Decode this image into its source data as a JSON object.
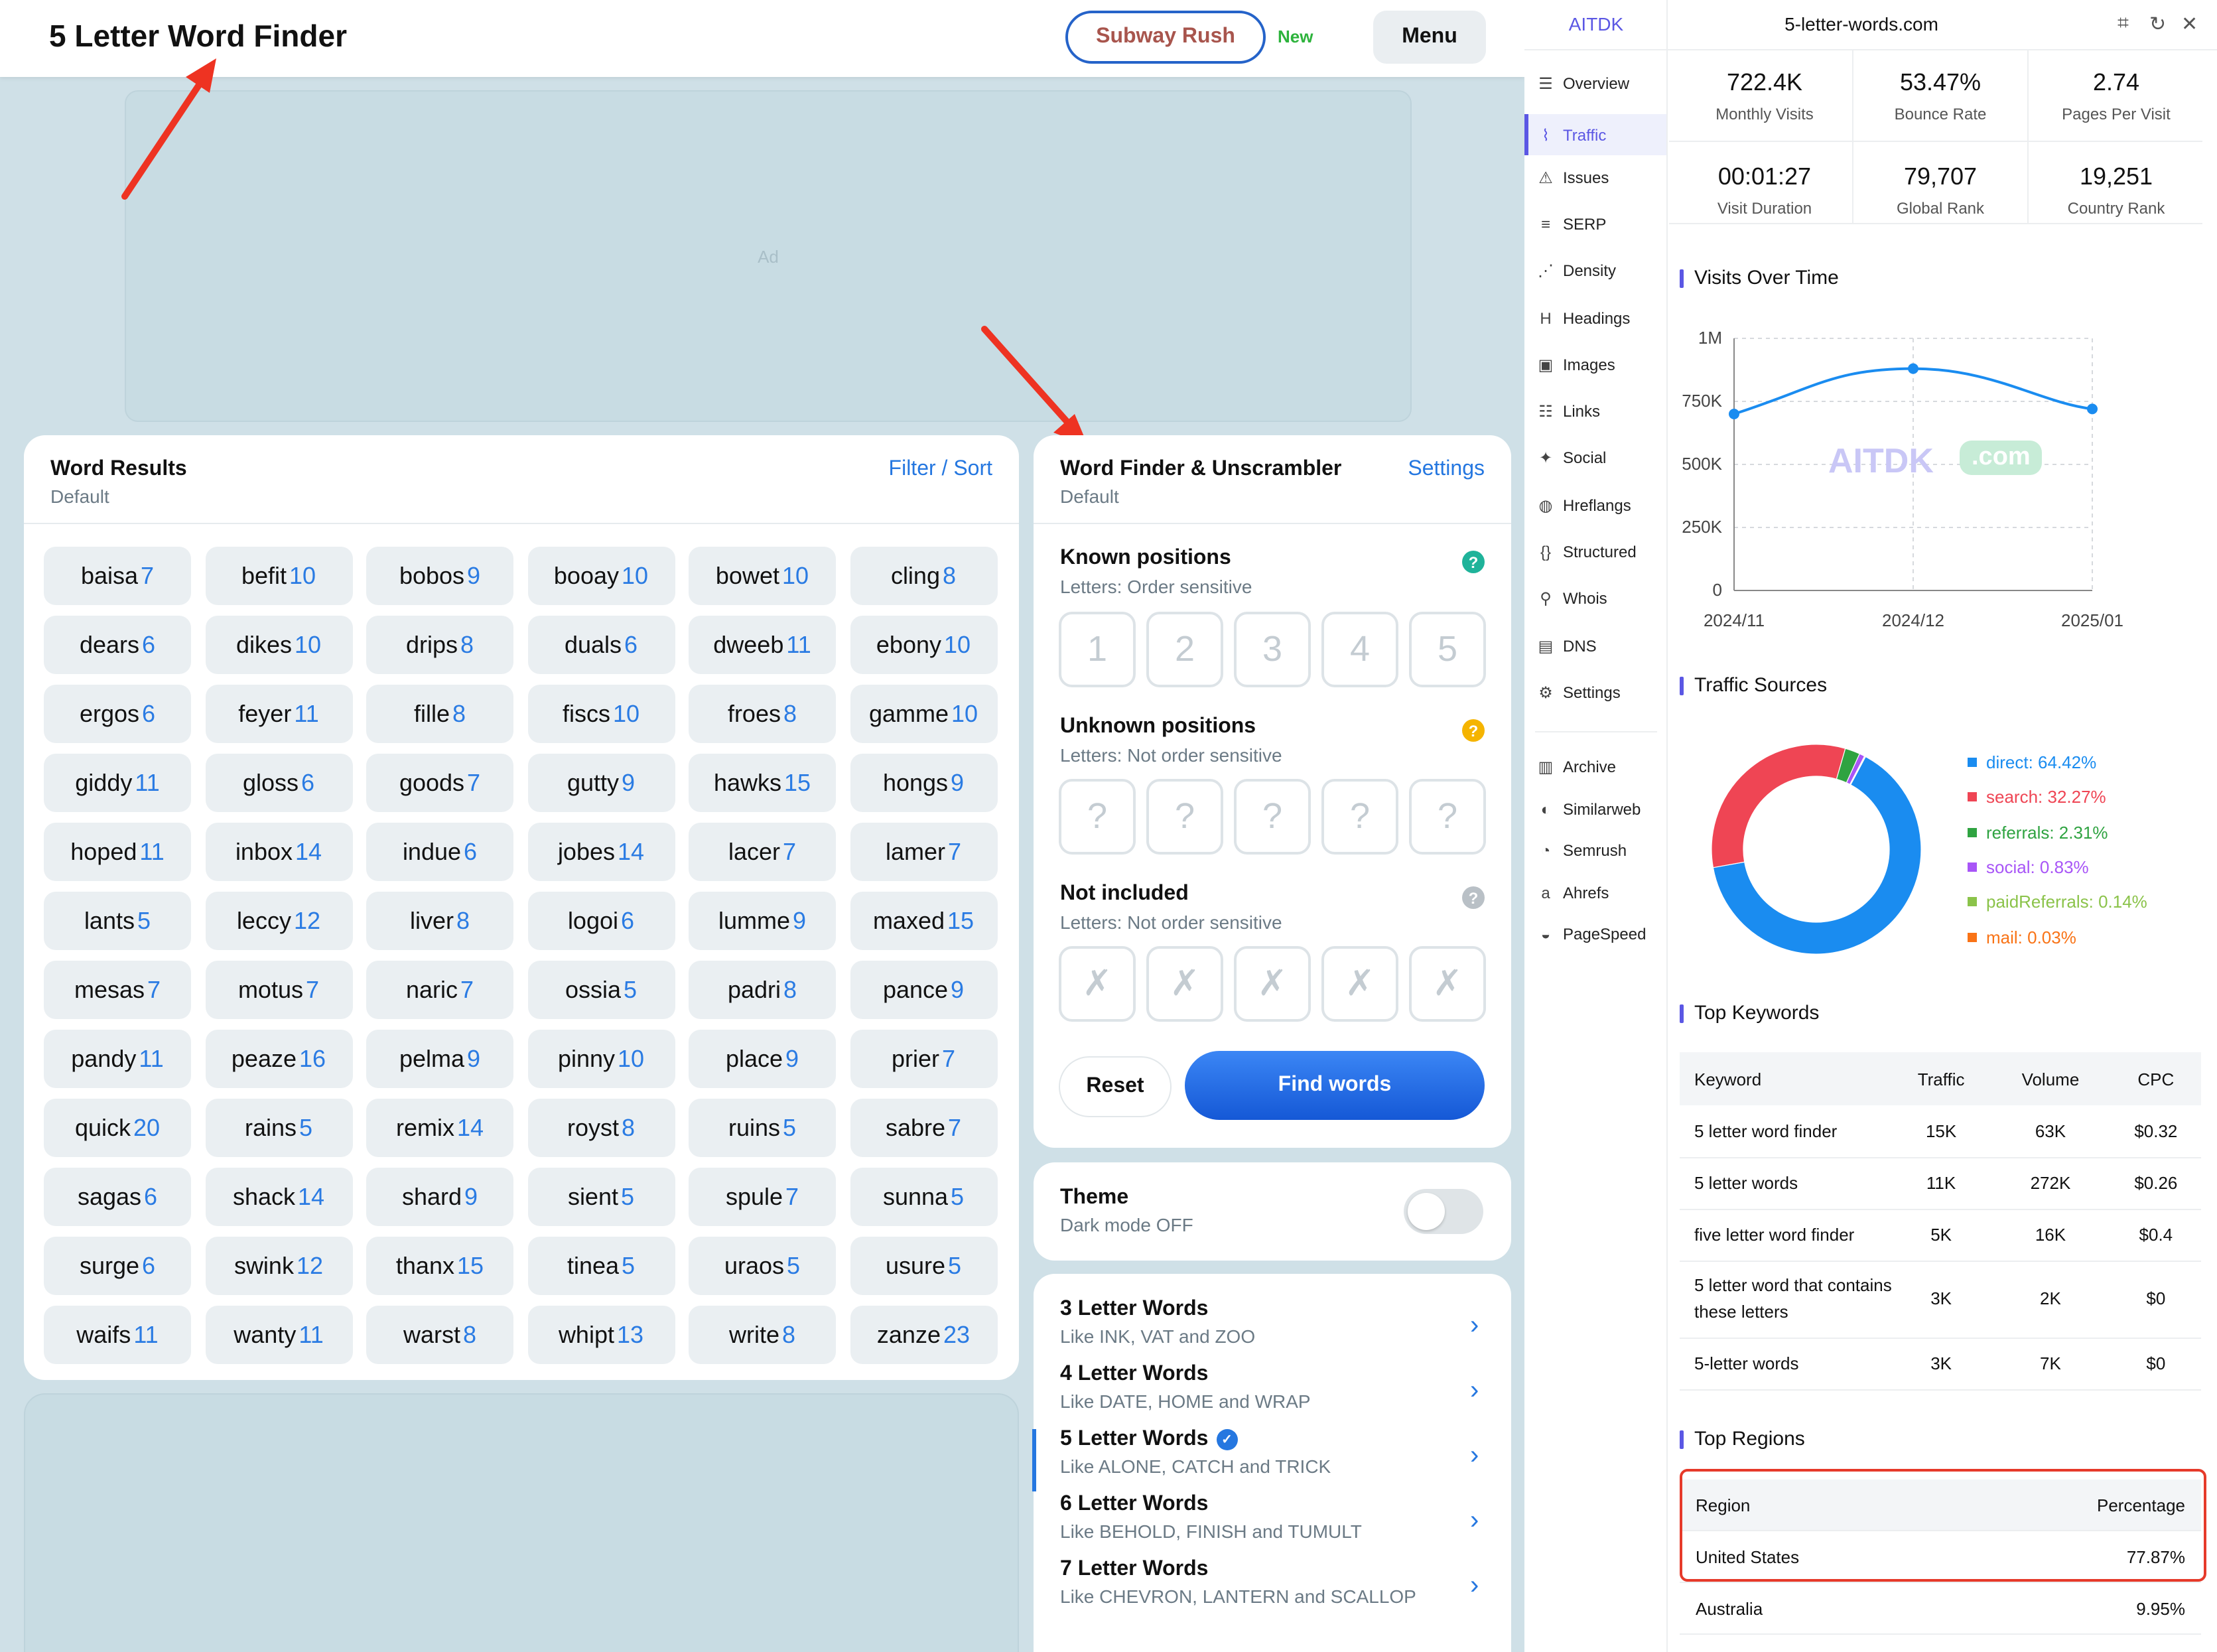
{
  "site": {
    "title": "5 Letter Word Finder",
    "subway_label": "Subway Rush",
    "new_badge": "New",
    "menu_label": "Menu",
    "ad_label": "Ad"
  },
  "results": {
    "title": "Word Results",
    "subtitle": "Default",
    "filter_link": "Filter / Sort",
    "words": [
      [
        "baisa",
        "7"
      ],
      [
        "befit",
        "10"
      ],
      [
        "bobos",
        "9"
      ],
      [
        "booay",
        "10"
      ],
      [
        "bowet",
        "10"
      ],
      [
        "cling",
        "8"
      ],
      [
        "dears",
        "6"
      ],
      [
        "dikes",
        "10"
      ],
      [
        "drips",
        "8"
      ],
      [
        "duals",
        "6"
      ],
      [
        "dweeb",
        "11"
      ],
      [
        "ebony",
        "10"
      ],
      [
        "ergos",
        "6"
      ],
      [
        "feyer",
        "11"
      ],
      [
        "fille",
        "8"
      ],
      [
        "fiscs",
        "10"
      ],
      [
        "froes",
        "8"
      ],
      [
        "gamme",
        "10"
      ],
      [
        "giddy",
        "11"
      ],
      [
        "gloss",
        "6"
      ],
      [
        "goods",
        "7"
      ],
      [
        "gutty",
        "9"
      ],
      [
        "hawks",
        "15"
      ],
      [
        "hongs",
        "9"
      ],
      [
        "hoped",
        "11"
      ],
      [
        "inbox",
        "14"
      ],
      [
        "indue",
        "6"
      ],
      [
        "jobes",
        "14"
      ],
      [
        "lacer",
        "7"
      ],
      [
        "lamer",
        "7"
      ],
      [
        "lants",
        "5"
      ],
      [
        "leccy",
        "12"
      ],
      [
        "liver",
        "8"
      ],
      [
        "logoi",
        "6"
      ],
      [
        "lumme",
        "9"
      ],
      [
        "maxed",
        "15"
      ],
      [
        "mesas",
        "7"
      ],
      [
        "motus",
        "7"
      ],
      [
        "naric",
        "7"
      ],
      [
        "ossia",
        "5"
      ],
      [
        "padri",
        "8"
      ],
      [
        "pance",
        "9"
      ],
      [
        "pandy",
        "11"
      ],
      [
        "peaze",
        "16"
      ],
      [
        "pelma",
        "9"
      ],
      [
        "pinny",
        "10"
      ],
      [
        "place",
        "9"
      ],
      [
        "prier",
        "7"
      ],
      [
        "quick",
        "20"
      ],
      [
        "rains",
        "5"
      ],
      [
        "remix",
        "14"
      ],
      [
        "royst",
        "8"
      ],
      [
        "ruins",
        "5"
      ],
      [
        "sabre",
        "7"
      ],
      [
        "sagas",
        "6"
      ],
      [
        "shack",
        "14"
      ],
      [
        "shard",
        "9"
      ],
      [
        "sient",
        "5"
      ],
      [
        "spule",
        "7"
      ],
      [
        "sunna",
        "5"
      ],
      [
        "surge",
        "6"
      ],
      [
        "swink",
        "12"
      ],
      [
        "thanx",
        "15"
      ],
      [
        "tinea",
        "5"
      ],
      [
        "uraos",
        "5"
      ],
      [
        "usure",
        "5"
      ],
      [
        "waifs",
        "11"
      ],
      [
        "wanty",
        "11"
      ],
      [
        "warst",
        "8"
      ],
      [
        "whipt",
        "13"
      ],
      [
        "write",
        "8"
      ],
      [
        "zanze",
        "23"
      ]
    ]
  },
  "finder": {
    "title": "Word Finder & Unscrambler",
    "subtitle": "Default",
    "settings_link": "Settings",
    "known": {
      "label": "Known positions",
      "sub": "Letters: Order sensitive",
      "help": "?",
      "boxes": [
        "1",
        "2",
        "3",
        "4",
        "5"
      ]
    },
    "unknown": {
      "label": "Unknown positions",
      "sub": "Letters: Not order sensitive",
      "help": "?",
      "boxes": [
        "?",
        "?",
        "?",
        "?",
        "?"
      ]
    },
    "excluded": {
      "label": "Not included",
      "sub": "Letters: Not order sensitive",
      "help": "?",
      "boxes": [
        "✗",
        "✗",
        "✗",
        "✗",
        "✗"
      ]
    },
    "reset_label": "Reset",
    "find_label": "Find words"
  },
  "theme": {
    "title": "Theme",
    "status": "Dark mode OFF"
  },
  "word_lists": [
    {
      "title": "3 Letter Words",
      "sub": "Like INK, VAT and ZOO"
    },
    {
      "title": "4 Letter Words",
      "sub": "Like DATE, HOME and WRAP"
    },
    {
      "title": "5 Letter Words",
      "sub": "Like ALONE, CATCH and TRICK",
      "active": true
    },
    {
      "title": "6 Letter Words",
      "sub": "Like BEHOLD, FINISH and TUMULT"
    },
    {
      "title": "7 Letter Words",
      "sub": "Like CHEVRON, LANTERN and SCALLOP"
    }
  ],
  "ext": {
    "brand": "AITDK",
    "domain": "5-letter-words.com",
    "nav": [
      {
        "label": "Overview",
        "icon": "overview-icon",
        "glyph": "☰"
      },
      {
        "label": "Traffic",
        "icon": "traffic-icon",
        "glyph": "⌇",
        "active": true
      },
      {
        "label": "Issues",
        "icon": "warning-icon",
        "glyph": "⚠"
      },
      {
        "label": "SERP",
        "icon": "serp-icon",
        "glyph": "≡"
      },
      {
        "label": "Density",
        "icon": "density-icon",
        "glyph": "⋰"
      },
      {
        "label": "Headings",
        "icon": "heading-icon",
        "glyph": "H"
      },
      {
        "label": "Images",
        "icon": "image-icon",
        "glyph": "▣"
      },
      {
        "label": "Links",
        "icon": "links-icon",
        "glyph": "☷"
      },
      {
        "label": "Social",
        "icon": "bird-icon",
        "glyph": "✦"
      },
      {
        "label": "Hreflangs",
        "icon": "globe-icon",
        "glyph": "◍"
      },
      {
        "label": "Structured",
        "icon": "braces-icon",
        "glyph": "{}"
      },
      {
        "label": "Whois",
        "icon": "user-search-icon",
        "glyph": "⚲"
      },
      {
        "label": "DNS",
        "icon": "server-icon",
        "glyph": "▤"
      },
      {
        "label": "Settings",
        "icon": "gear-icon",
        "glyph": "⚙"
      }
    ],
    "tools": [
      {
        "label": "Archive",
        "icon": "archive-icon",
        "glyph": "▥"
      },
      {
        "label": "Similarweb",
        "icon": "similarweb-icon",
        "glyph": "◐"
      },
      {
        "label": "Semrush",
        "icon": "semrush-icon",
        "glyph": "◔"
      },
      {
        "label": "Ahrefs",
        "icon": "ahrefs-icon",
        "glyph": "a"
      },
      {
        "label": "PageSpeed",
        "icon": "pagespeed-icon",
        "glyph": "◒"
      }
    ],
    "stats": [
      {
        "value": "722.4K",
        "label": "Monthly Visits"
      },
      {
        "value": "53.47%",
        "label": "Bounce Rate"
      },
      {
        "value": "2.74",
        "label": "Pages Per Visit"
      },
      {
        "value": "00:01:27",
        "label": "Visit Duration"
      },
      {
        "value": "79,707",
        "label": "Global Rank"
      },
      {
        "value": "19,251",
        "label": "Country Rank"
      }
    ],
    "visits_title": "Visits Over Time",
    "sources_title": "Traffic Sources",
    "keywords_title": "Top Keywords",
    "regions_title": "Top Regions",
    "watermark": "AITDK",
    "watermark_tag": ".com",
    "keywords": {
      "headers": [
        "Keyword",
        "Traffic",
        "Volume",
        "CPC"
      ],
      "rows": [
        [
          "5 letter word finder",
          "15K",
          "63K",
          "$0.32"
        ],
        [
          "5 letter words",
          "11K",
          "272K",
          "$0.26"
        ],
        [
          "five letter word finder",
          "5K",
          "16K",
          "$0.4"
        ],
        [
          "5 letter word that contains these letters",
          "3K",
          "2K",
          "$0"
        ],
        [
          "5-letter words",
          "3K",
          "7K",
          "$0"
        ]
      ]
    },
    "regions": {
      "headers": [
        "Region",
        "Percentage"
      ],
      "rows": [
        [
          "United States",
          "77.87%"
        ],
        [
          "Australia",
          "9.95%"
        ]
      ]
    }
  },
  "chart_data": [
    {
      "type": "line",
      "title": "Visits Over Time",
      "x": [
        "2024/11",
        "2024/12",
        "2025/01"
      ],
      "series": [
        {
          "values": [
            700000,
            880000,
            720000
          ]
        }
      ],
      "yticks": [
        "0",
        "250K",
        "500K",
        "750K",
        "1M"
      ],
      "ylim": [
        0,
        1000000
      ],
      "grid": true,
      "color": "#1a8cf0"
    },
    {
      "type": "pie",
      "title": "Traffic Sources",
      "donut": true,
      "legend": "right",
      "series": [
        {
          "name": "direct",
          "value": 64.42,
          "label": "direct: 64.42%",
          "color": "#1a8cf0"
        },
        {
          "name": "search",
          "value": 32.27,
          "label": "search: 32.27%",
          "color": "#ef4554"
        },
        {
          "name": "referrals",
          "value": 2.31,
          "label": "referrals: 2.31%",
          "color": "#2fa341"
        },
        {
          "name": "social",
          "value": 0.83,
          "label": "social: 0.83%",
          "color": "#a855f7"
        },
        {
          "name": "paidReferrals",
          "value": 0.14,
          "label": "paidReferrals: 0.14%",
          "color": "#8bc34a"
        },
        {
          "name": "mail",
          "value": 0.03,
          "label": "mail: 0.03%",
          "color": "#f97316"
        }
      ]
    }
  ]
}
